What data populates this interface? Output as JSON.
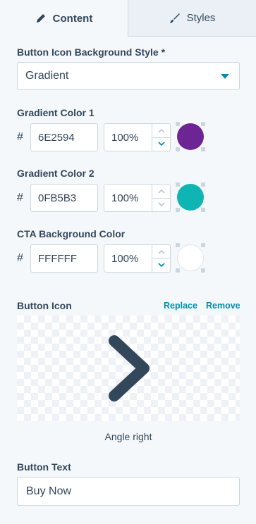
{
  "tabs": {
    "content": "Content",
    "styles": "Styles"
  },
  "bg_style": {
    "label": "Button Icon Background Style *",
    "value": "Gradient"
  },
  "gradient1": {
    "label": "Gradient Color 1",
    "hash": "#",
    "hex": "6E2594",
    "opacity": "100%",
    "color": "#6e2594"
  },
  "gradient2": {
    "label": "Gradient Color 2",
    "hash": "#",
    "hex": "0FB5B3",
    "opacity": "100%",
    "color": "#0fb5b3"
  },
  "cta": {
    "label": "CTA Background Color",
    "hash": "#",
    "hex": "FFFFFF",
    "opacity": "100%",
    "color": "#ffffff"
  },
  "button_icon": {
    "label": "Button Icon",
    "replace": "Replace",
    "remove": "Remove",
    "icon_name": "angle-right-icon",
    "caption": "Angle right"
  },
  "button_text": {
    "label": "Button Text",
    "value": "Buy Now"
  },
  "colors": {
    "accent": "#0091ae",
    "text": "#33475b",
    "border": "#cbd6e2"
  }
}
